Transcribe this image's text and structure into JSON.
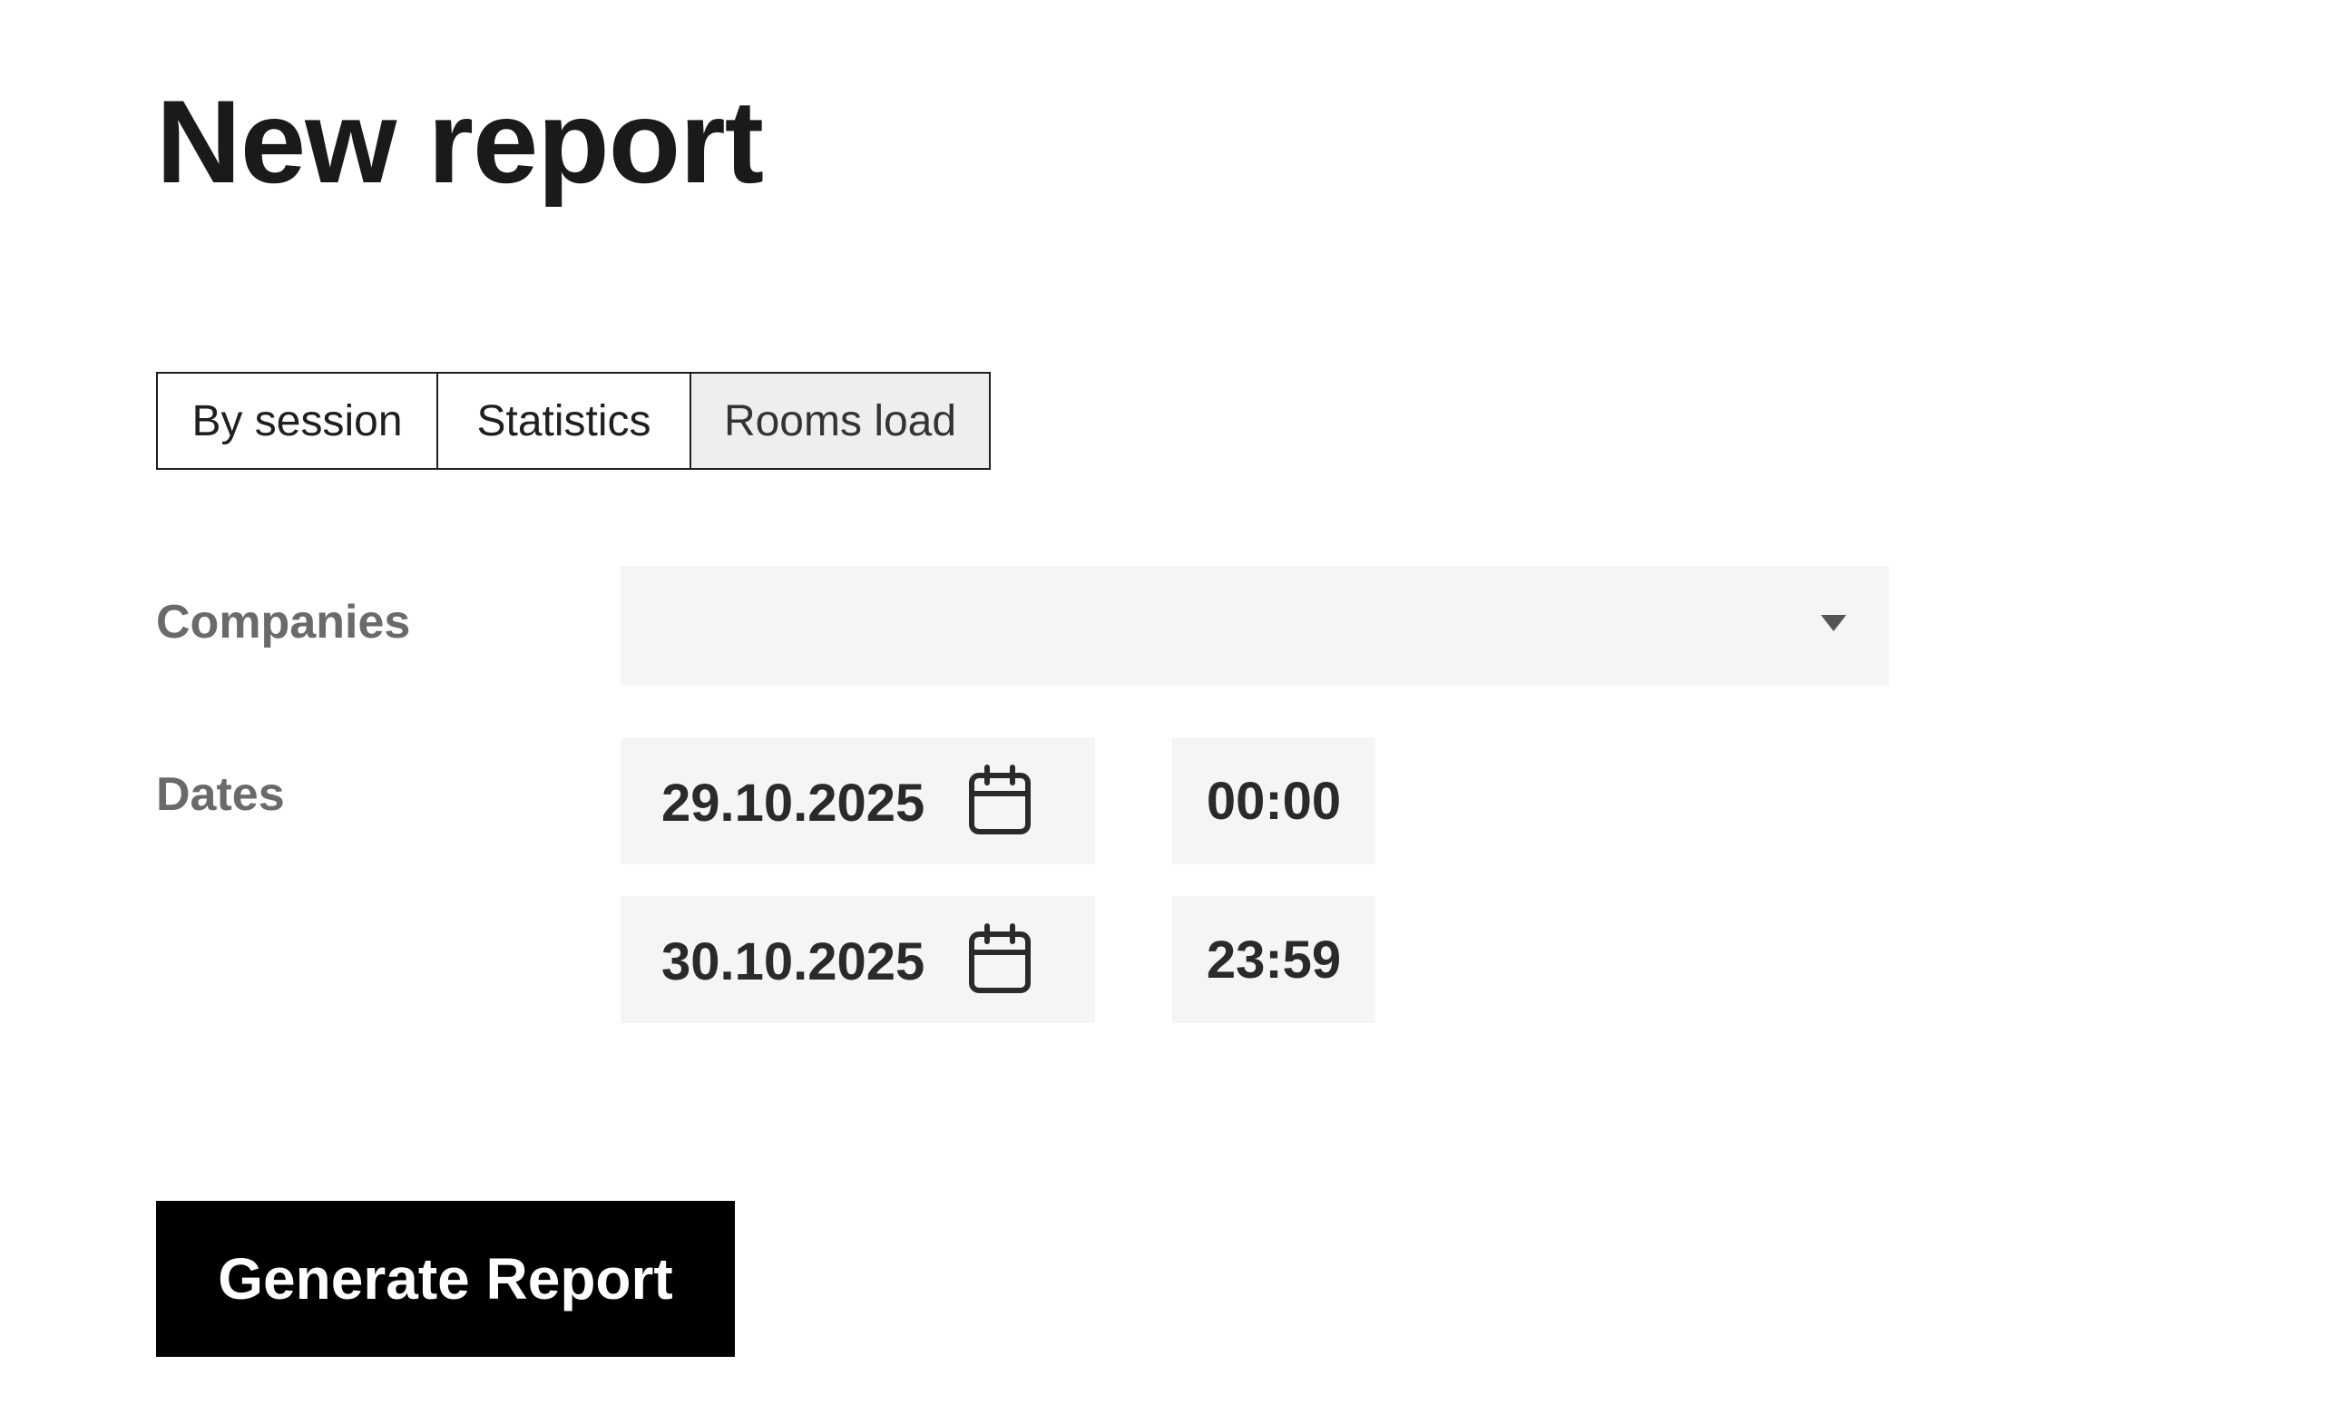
{
  "page": {
    "title": "New report"
  },
  "tabs": [
    {
      "label": "By session",
      "active": false
    },
    {
      "label": "Statistics",
      "active": false
    },
    {
      "label": "Rooms load",
      "active": true
    }
  ],
  "form": {
    "companies": {
      "label": "Companies",
      "value": "",
      "icon": "chevron-down-icon"
    },
    "dates": {
      "label": "Dates",
      "start_date": "29.10.2025",
      "start_time": "00:00",
      "end_date": "30.10.2025",
      "end_time": "23:59",
      "icon": "calendar-icon"
    }
  },
  "actions": {
    "generate_label": "Generate Report"
  },
  "colors": {
    "field_background": "#f5f5f5",
    "active_tab_background": "#eeeeee",
    "button_background": "#000000",
    "label_color": "#6a6a6a"
  }
}
